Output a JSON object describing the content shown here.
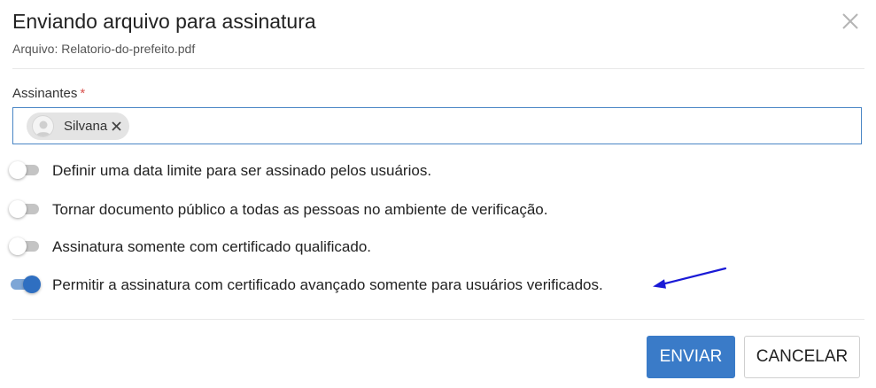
{
  "dialog": {
    "title": "Enviando arquivo para assinatura",
    "subtitle": "Arquivo: Relatorio-do-prefeito.pdf",
    "close_icon": "close-icon"
  },
  "signers": {
    "label": "Assinantes",
    "required_mark": "*",
    "chips": [
      {
        "name": "Silvana",
        "avatar_icon": "user-avatar-icon",
        "remove_icon": "close-icon"
      }
    ]
  },
  "options": [
    {
      "label": "Definir uma data limite para ser assinado pelos usuários.",
      "enabled": false
    },
    {
      "label": "Tornar documento público a todas as pessoas no ambiente de verificação.",
      "enabled": false
    },
    {
      "label": "Assinatura somente com certificado qualificado.",
      "enabled": false
    },
    {
      "label": "Permitir a assinatura com certificado avançado somente para usuários verificados.",
      "enabled": true
    }
  ],
  "annotation": {
    "arrow_color": "#1a1ad6",
    "icon": "arrow-pointer-icon"
  },
  "actions": {
    "send_label": "ENVIAR",
    "cancel_label": "CANCELAR"
  },
  "colors": {
    "primary": "#3a7bc8",
    "switch_on": "#2f6fc1",
    "required": "#d9534f",
    "input_focus_border": "#4a86c5"
  }
}
